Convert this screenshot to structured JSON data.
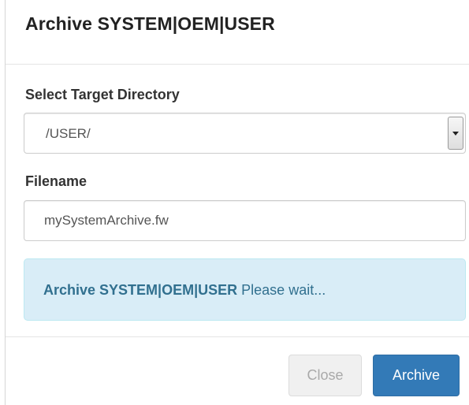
{
  "dialog": {
    "title": "Archive SYSTEM|OEM|USER"
  },
  "form": {
    "directory_label": "Select Target Directory",
    "directory_value": "/USER/",
    "filename_label": "Filename",
    "filename_value": "mySystemArchive.fw"
  },
  "alert": {
    "strong_text": "Archive SYSTEM|OEM|USER",
    "message": "Please wait...",
    "colors": {
      "background": "#d9edf7",
      "border": "#bce8f1",
      "text": "#31708f"
    }
  },
  "footer": {
    "close_label": "Close",
    "archive_label": "Archive",
    "colors": {
      "primary": "#337ab7"
    }
  },
  "icons": {
    "select_arrow": "chevron-down-icon"
  }
}
